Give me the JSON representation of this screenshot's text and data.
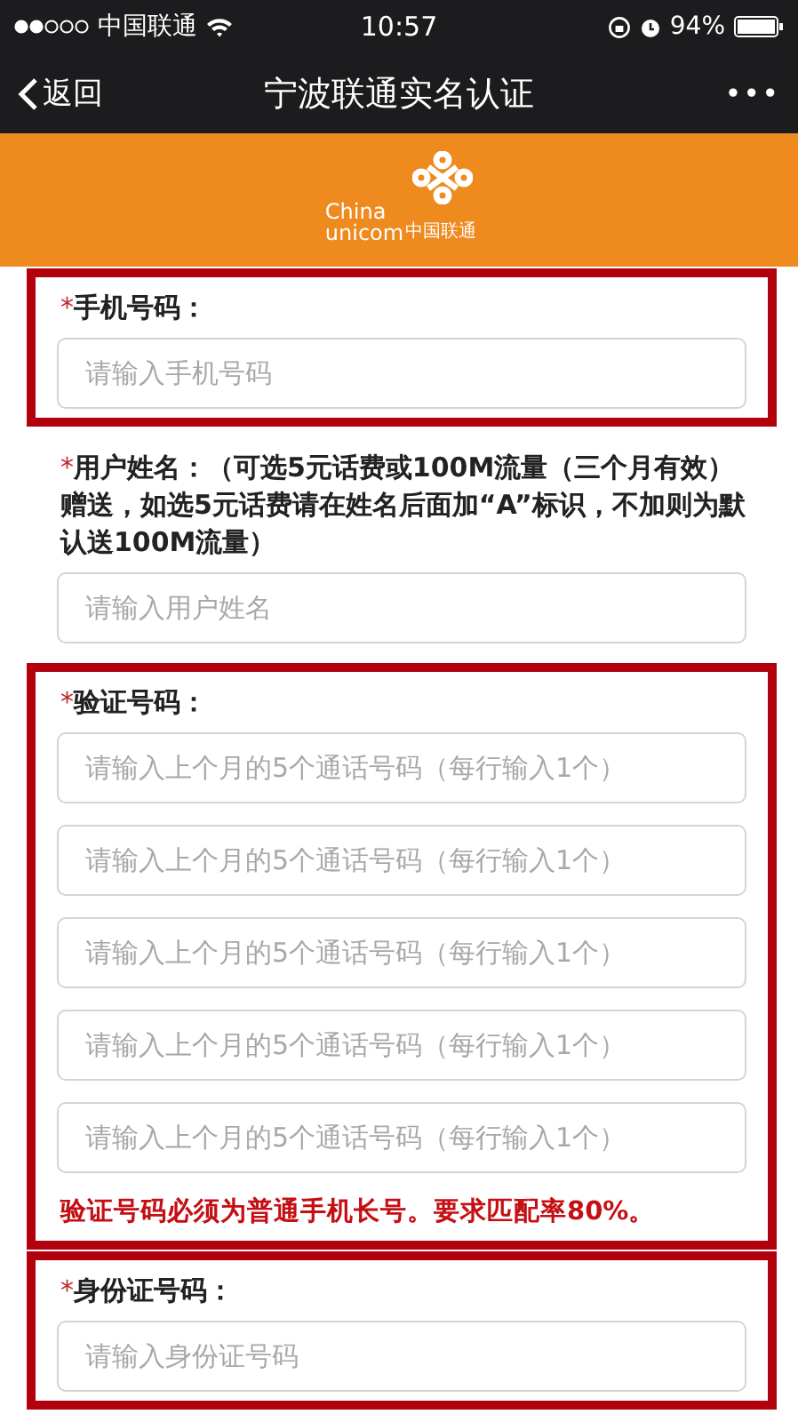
{
  "status_bar": {
    "carrier": "中国联通",
    "time": "10:57",
    "battery": "94%"
  },
  "nav": {
    "back": "返回",
    "title": "宁波联通实名认证",
    "more": "•••"
  },
  "banner": {
    "logo_line_1": "China",
    "logo_line_2": "unicom",
    "logo_cn": "中国联通"
  },
  "sections": [
    {
      "highlighted": true,
      "required_mark": "*",
      "label": "手机号码：",
      "fields": [
        {
          "placeholder": "请输入手机号码"
        }
      ]
    },
    {
      "highlighted": false,
      "required_mark": "*",
      "label": "用户姓名：（可选5元话费或100M流量（三个月有效）赠送，如选5元话费请在姓名后面加“A”标识，不加则为默认送100M流量）",
      "fields": [
        {
          "placeholder": "请输入用户姓名"
        }
      ]
    },
    {
      "highlighted": true,
      "required_mark": "*",
      "label": "验证号码：",
      "fields": [
        {
          "placeholder": "请输入上个月的5个通话号码（每行输入1个）"
        },
        {
          "placeholder": "请输入上个月的5个通话号码（每行输入1个）"
        },
        {
          "placeholder": "请输入上个月的5个通话号码（每行输入1个）"
        },
        {
          "placeholder": "请输入上个月的5个通话号码（每行输入1个）"
        },
        {
          "placeholder": "请输入上个月的5个通话号码（每行输入1个）"
        }
      ],
      "note": "验证号码必须为普通手机长号。要求匹配率80%。"
    },
    {
      "highlighted": true,
      "required_mark": "*",
      "label": "身份证号码：",
      "fields": [
        {
          "placeholder": "请输入身份证号码"
        }
      ]
    }
  ]
}
